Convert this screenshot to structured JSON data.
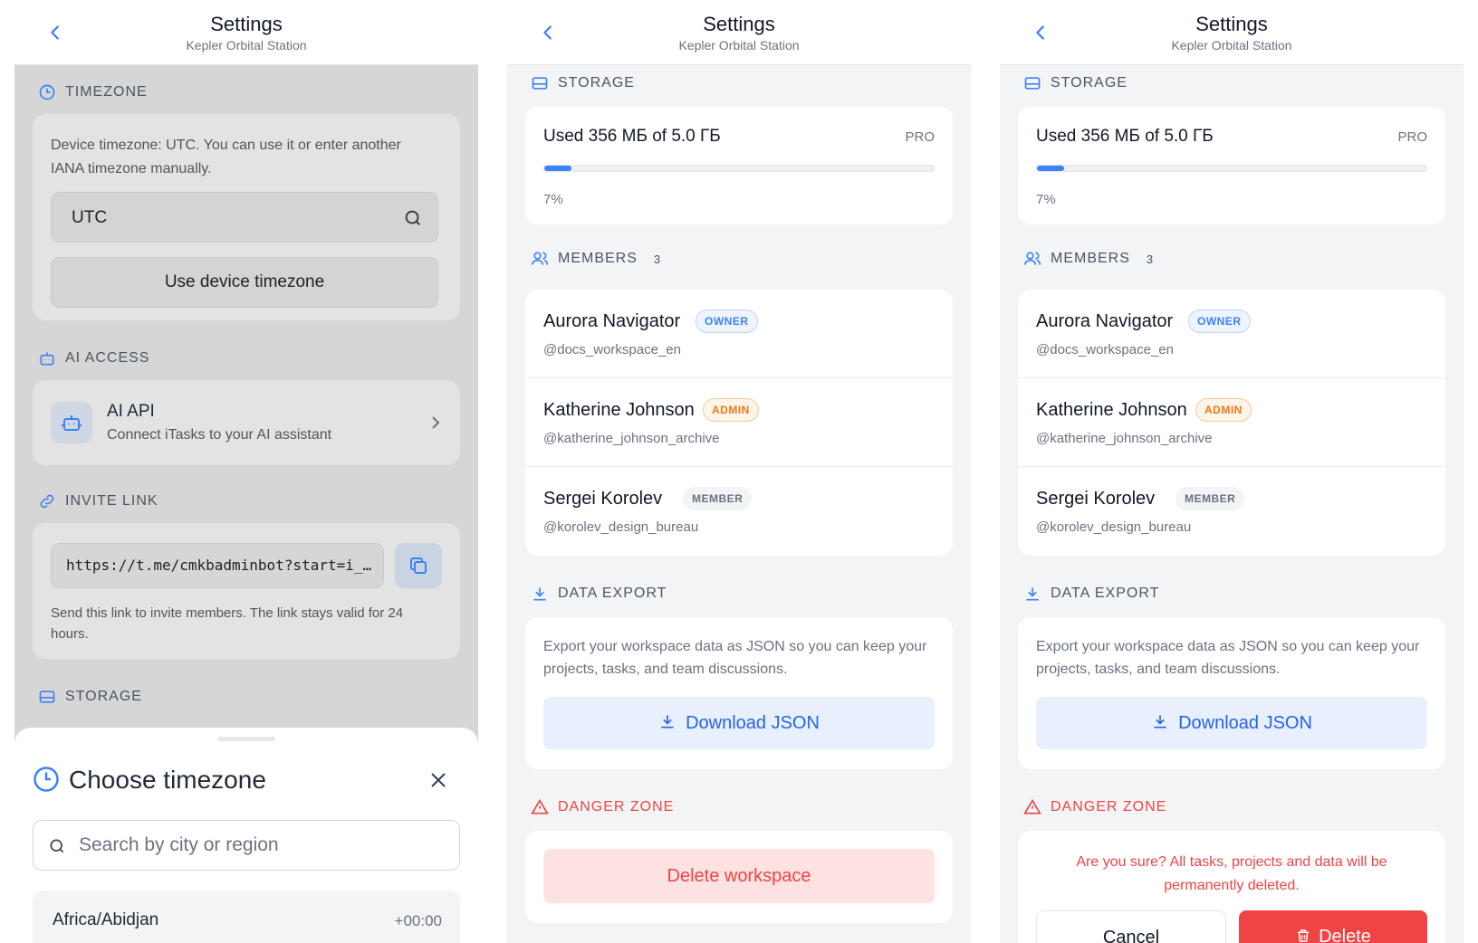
{
  "header": {
    "title": "Settings",
    "subtitle": "Kepler Orbital Station"
  },
  "timezone": {
    "section_label": "TIMEZONE",
    "description": "Device timezone: UTC. You can use it or enter another IANA timezone manually.",
    "value": "UTC",
    "use_device_button": "Use device timezone"
  },
  "ai_access": {
    "section_label": "AI ACCESS",
    "title": "AI API",
    "subtitle": "Connect iTasks to your AI assistant"
  },
  "invite": {
    "section_label": "INVITE LINK",
    "link": "https://t.me/cmkbadminbot?start=i_…",
    "hint": "Send this link to invite members. The link stays valid for 24 hours."
  },
  "storage": {
    "section_label": "STORAGE",
    "used_text": "Used 356 МБ of 5.0 ГБ",
    "plan": "PRO",
    "percent_label": "7%",
    "percent": 7
  },
  "members": {
    "section_label": "MEMBERS",
    "count": "3",
    "list": [
      {
        "name": "Aurora Navigator",
        "username": "@docs_workspace_en",
        "role": "OWNER"
      },
      {
        "name": "Katherine Johnson",
        "username": "@katherine_johnson_archive",
        "role": "ADMIN"
      },
      {
        "name": "Sergei Korolev",
        "username": "@korolev_design_bureau",
        "role": "MEMBER"
      }
    ]
  },
  "export": {
    "section_label": "DATA EXPORT",
    "description": "Export your workspace data as JSON so you can keep your projects, tasks, and team discussions.",
    "button": "Download JSON"
  },
  "danger": {
    "section_label": "DANGER ZONE",
    "delete_workspace": "Delete workspace",
    "confirm_text": "Are you sure? All tasks, projects and data will be permanently deleted.",
    "cancel": "Cancel",
    "delete": "Delete"
  },
  "timezone_sheet": {
    "title": "Choose timezone",
    "search_placeholder": "Search by city or region",
    "items": [
      {
        "name": "Africa/Abidjan",
        "offset": "+00:00"
      }
    ]
  },
  "colors": {
    "accent": "#3b82f6",
    "danger": "#ef4444",
    "admin": "#ea7a1a"
  }
}
